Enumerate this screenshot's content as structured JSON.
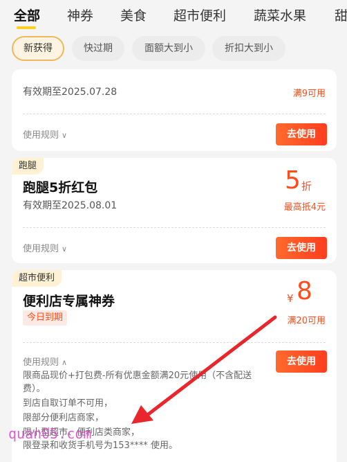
{
  "category_tabs": [
    "全部",
    "神券",
    "美食",
    "超市便利",
    "蔬菜水果",
    "甜"
  ],
  "filters": [
    "新获得",
    "快过期",
    "面额大到小",
    "折扣大到小"
  ],
  "cards": [
    {
      "validity": "有效期至2025.07.28",
      "condition": "满9可用",
      "rules_label": "使用规则",
      "button": "去使用"
    },
    {
      "tag": "跑腿",
      "title": "跑腿5折红包",
      "validity": "有效期至2025.08.01",
      "value": "5",
      "unit": "折",
      "condition": "最高抵4元",
      "rules_label": "使用规则",
      "button": "去使用"
    },
    {
      "tag": "超市便利",
      "title": "便利店专属神券",
      "expire_badge": "今日到期",
      "symbol": "¥",
      "value": "8",
      "condition": "满20可用",
      "rules_label": "使用规则",
      "button": "去使用",
      "rules": [
        "限商品现价+打包费-所有优惠金额满20元使用（不含配送",
        "费）。",
        "到店自取订单不可用，",
        "限部分便利店商家，",
        "限小型超市、便利店类商家，",
        "限登录和收货手机号为153****        使用。"
      ]
    }
  ],
  "watermark": "quan05.com",
  "colors": {
    "accent": "#ff4d1a",
    "highlight": "#ffcf1f",
    "arrow": "#e8262b"
  }
}
